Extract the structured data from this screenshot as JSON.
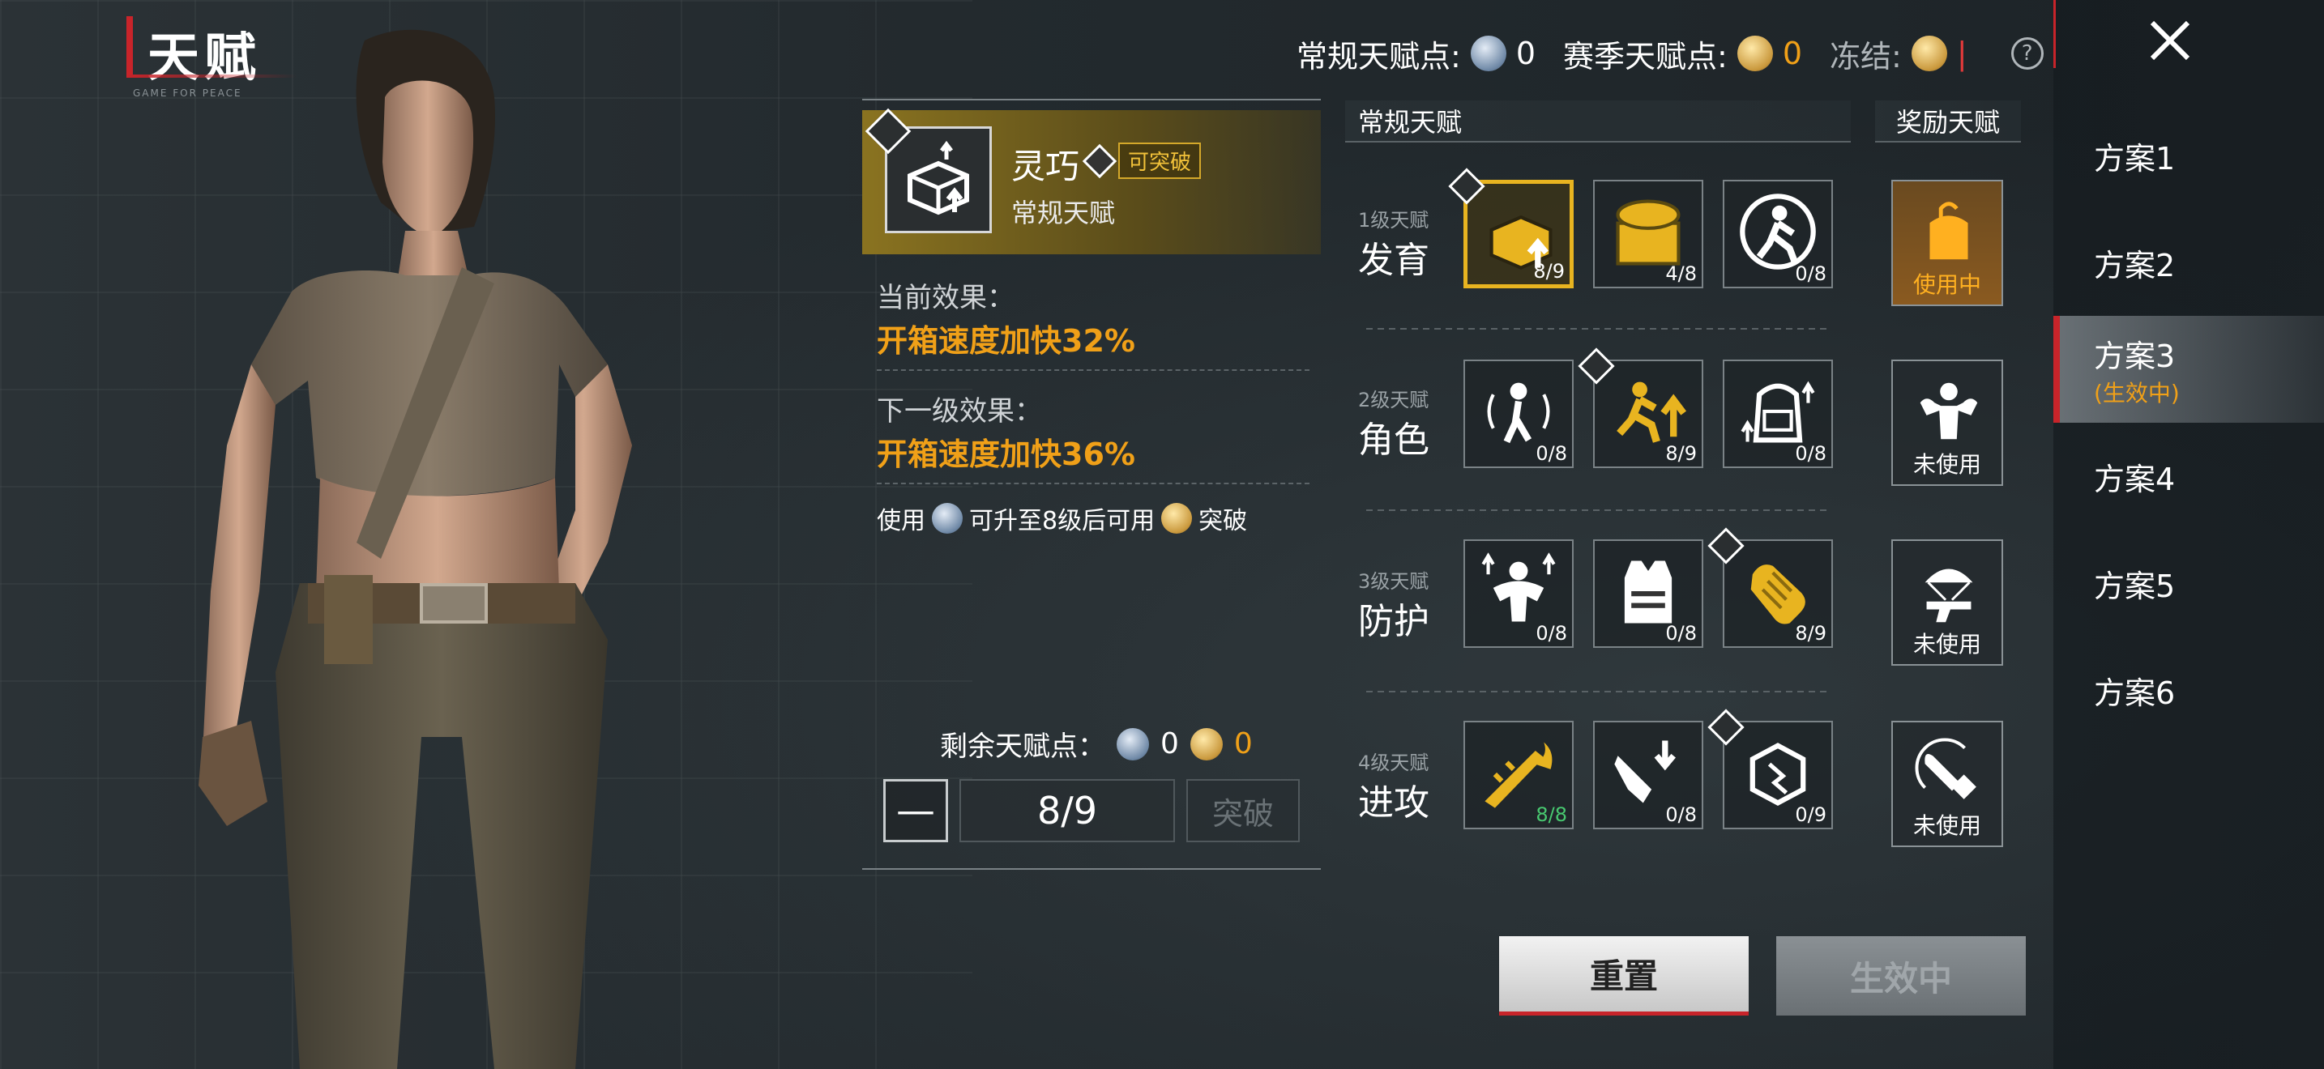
{
  "header": {
    "title": "天赋",
    "subtag": "GAME FOR PEACE"
  },
  "points": {
    "regular_label": "常规天赋点:",
    "regular_value": "0",
    "season_label": "赛季天赋点:",
    "season_value": "0",
    "frozen_label": "冻结:",
    "frozen_value": "|",
    "help": "?"
  },
  "detail": {
    "name": "灵巧",
    "badge": "可突破",
    "type": "常规天赋",
    "current_label": "当前效果：",
    "current_effect": "开箱速度加快32%",
    "next_label": "下一级效果：",
    "next_effect": "开箱速度加快36%",
    "hint_use": "使用",
    "hint_mid": "可升至8级后可用",
    "hint_break": "突破",
    "remain_label": "剩余天赋点：",
    "remain_regular": "0",
    "remain_season": "0",
    "minus": "—",
    "level_value": "8/9",
    "break_button": "突破"
  },
  "grid": {
    "regular_header": "常规天赋",
    "bonus_header": "奖励天赋",
    "tiers": [
      {
        "level": "1级天赋",
        "name": "发育",
        "cells": [
          {
            "icon": "loot-box-speed-icon",
            "count": "8/9"
          },
          {
            "icon": "treasure-chest-icon",
            "count": "4/8"
          },
          {
            "icon": "running-soldier-icon",
            "count": "0/8"
          }
        ],
        "bonus": {
          "icon": "backpack-unlock-icon",
          "status": "使用中"
        }
      },
      {
        "level": "2级天赋",
        "name": "角色",
        "cells": [
          {
            "icon": "soldier-sound-icon",
            "count": "0/8"
          },
          {
            "icon": "sprint-up-icon",
            "count": "8/9"
          },
          {
            "icon": "backpack-upgrade-icon",
            "count": "0/8"
          }
        ],
        "bonus": {
          "icon": "strong-soldier-icon",
          "status": "未使用"
        }
      },
      {
        "level": "3级天赋",
        "name": "防护",
        "cells": [
          {
            "icon": "armor-buff-icon",
            "count": "0/8"
          },
          {
            "icon": "vest-upgrade-icon",
            "count": "0/8"
          },
          {
            "icon": "glove-icon",
            "count": "8/9"
          }
        ],
        "bonus": {
          "icon": "airdrop-pistol-icon",
          "status": "未使用"
        }
      },
      {
        "level": "4级天赋",
        "name": "进攻",
        "cells": [
          {
            "icon": "rifle-fire-icon",
            "count": "8/8"
          },
          {
            "icon": "weapon-reload-icon",
            "count": "0/8"
          },
          {
            "icon": "cube-break-icon",
            "count": "0/9"
          }
        ],
        "bonus": {
          "icon": "bullet-icon",
          "status": "未使用"
        }
      }
    ]
  },
  "schemes": [
    {
      "label": "方案1"
    },
    {
      "label": "方案2"
    },
    {
      "label": "方案3",
      "status": "(生效中)"
    },
    {
      "label": "方案4"
    },
    {
      "label": "方案5"
    },
    {
      "label": "方案6"
    }
  ],
  "buttons": {
    "reset": "重置",
    "active": "生效中"
  },
  "colors": {
    "accent_red": "#c8242a",
    "gold": "#f0a018",
    "selected_border": "#e8b420"
  }
}
